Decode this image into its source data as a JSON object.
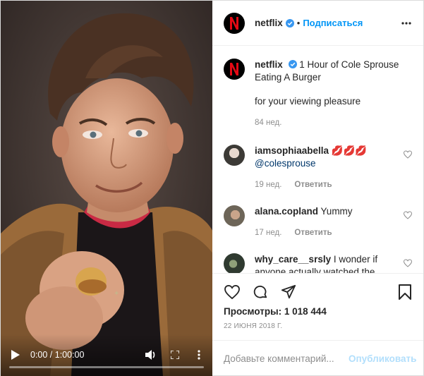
{
  "video": {
    "time": "0:00 / 1:00:00",
    "progress": 0
  },
  "header": {
    "username": "netflix",
    "separator": "•",
    "follow_label": "Подписаться"
  },
  "caption": {
    "username": "netflix",
    "text": "1 Hour of Cole Sprouse Eating A Burger",
    "text2": "for your viewing pleasure",
    "age": "84 нед."
  },
  "comments": [
    {
      "username": "iamsophiaabella",
      "text": "💋💋💋",
      "mention": "@colesprouse",
      "age": "19 нед.",
      "reply": "Ответить"
    },
    {
      "username": "alana.copland",
      "text": "Yummy",
      "age": "17 нед.",
      "reply": "Ответить"
    },
    {
      "username": "why_care__srsly",
      "text": "I wonder if anyone actually watched the whole thing 😂😂😂"
    }
  ],
  "stats": {
    "views": "Просмотры: 1 018 444",
    "date": "22 ИЮНЯ 2018 Г."
  },
  "add_comment": {
    "placeholder": "Добавьте комментарий...",
    "post_label": "Опубликовать"
  },
  "colors": {
    "accent": "#0095f6",
    "netflix_red": "#e50914",
    "post_disabled": "#b2dffc"
  }
}
